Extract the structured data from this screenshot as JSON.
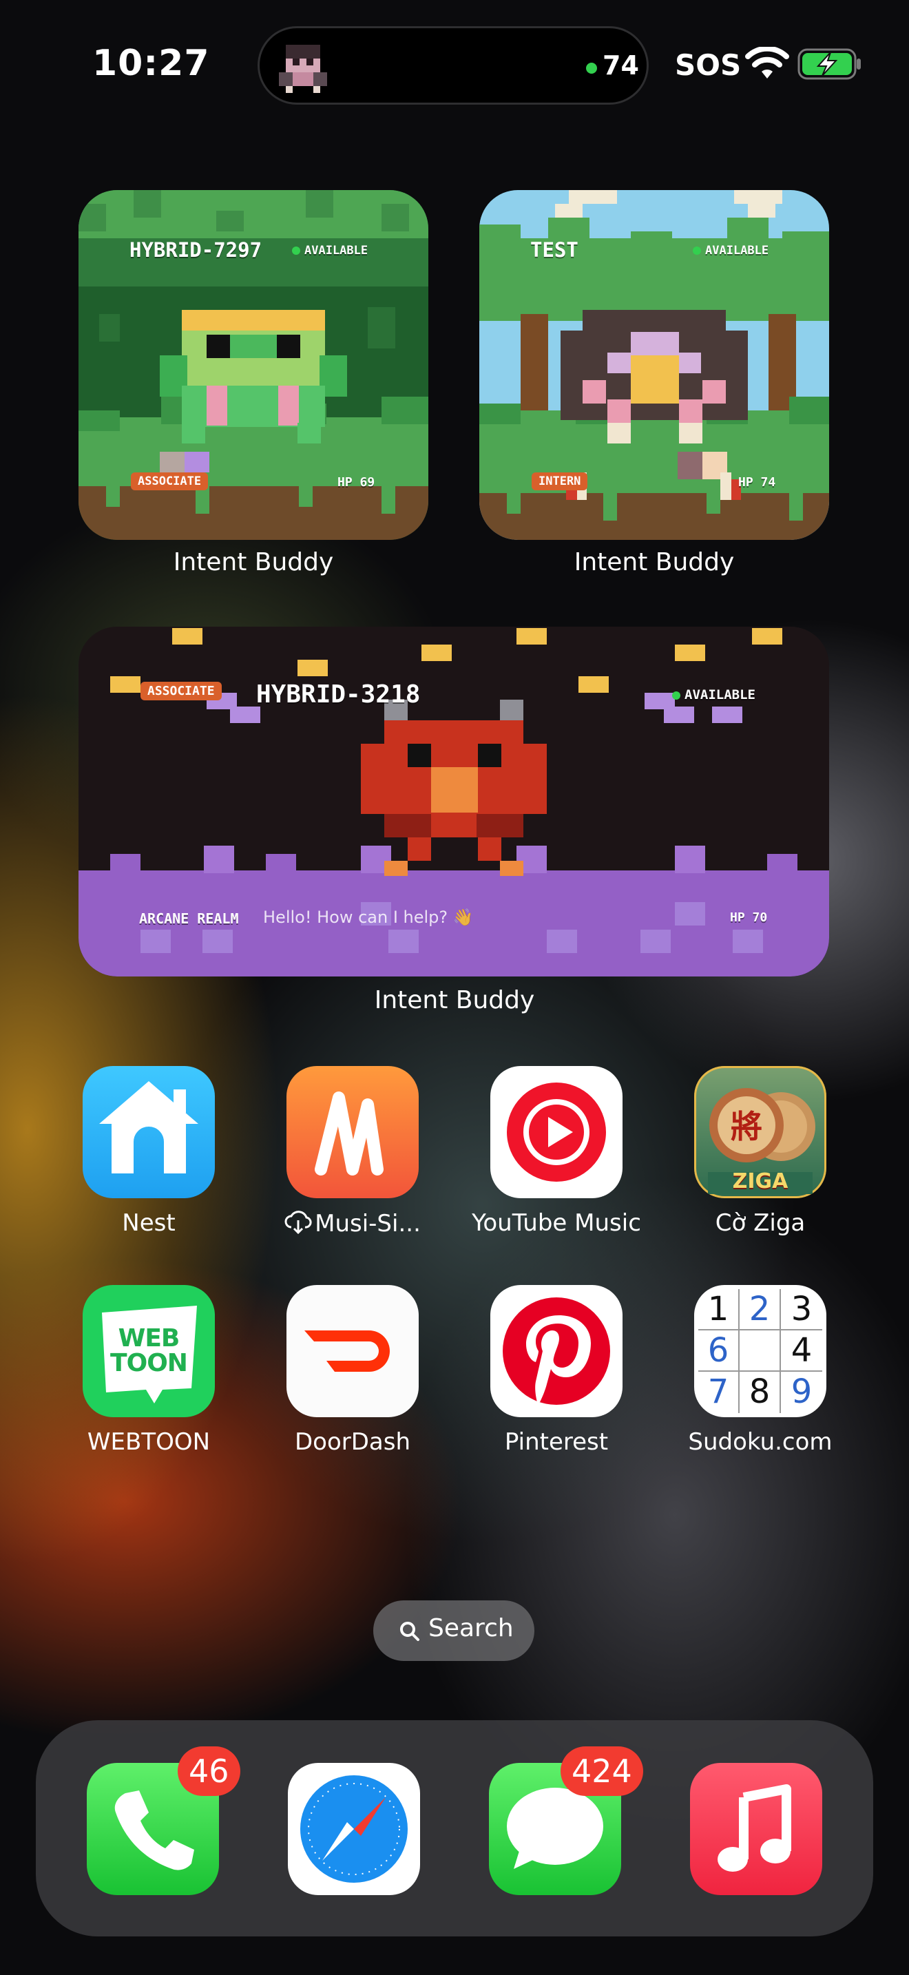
{
  "status_bar": {
    "time": "10:27",
    "activity_value": "74",
    "carrier": "SOS",
    "wifi_icon": "wifi-icon",
    "battery_icon": "battery-charging-icon"
  },
  "widgets": [
    {
      "name": "HYBRID-7297",
      "status": "AVAILABLE",
      "rank": "ASSOCIATE",
      "hp": "HP 69",
      "label": "Intent Buddy"
    },
    {
      "name": "TEST",
      "status": "AVAILABLE",
      "rank": "INTERN",
      "hp": "HP 74",
      "label": "Intent Buddy"
    },
    {
      "name": "HYBRID-3218",
      "status": "AVAILABLE",
      "rank": "ASSOCIATE",
      "hp": "HP 70",
      "realm": "ARCANE REALM",
      "message": "Hello! How can I help? 👋",
      "label": "Intent Buddy"
    }
  ],
  "apps": [
    {
      "label": "Nest",
      "icon": "nest-home-icon"
    },
    {
      "label": "Musi-Si...",
      "icon": "musi-icon",
      "prefix_icon": "cloud-download-icon"
    },
    {
      "label": "YouTube Music",
      "icon": "youtube-music-icon"
    },
    {
      "label": "Cờ Ziga",
      "icon": "co-ziga-icon",
      "icon_text": "ZIGA"
    },
    {
      "label": "WEBTOON",
      "icon": "webtoon-icon",
      "icon_text": "WEB TOON"
    },
    {
      "label": "DoorDash",
      "icon": "doordash-icon"
    },
    {
      "label": "Pinterest",
      "icon": "pinterest-icon"
    },
    {
      "label": "Sudoku.com",
      "icon": "sudoku-icon",
      "grid": [
        "1",
        "2",
        "3",
        "6",
        "",
        "4",
        "7",
        "8",
        "9"
      ]
    }
  ],
  "search": {
    "label": "Search"
  },
  "dock": [
    {
      "icon": "phone-icon",
      "badge": "46"
    },
    {
      "icon": "safari-icon",
      "badge": ""
    },
    {
      "icon": "messages-icon",
      "badge": "424"
    },
    {
      "icon": "music-icon",
      "badge": ""
    }
  ],
  "colors": {
    "badge": "#f23b30",
    "rank_chip": "#d9602b",
    "available": "#33d04f",
    "widget3_ground": "#9460c6"
  }
}
